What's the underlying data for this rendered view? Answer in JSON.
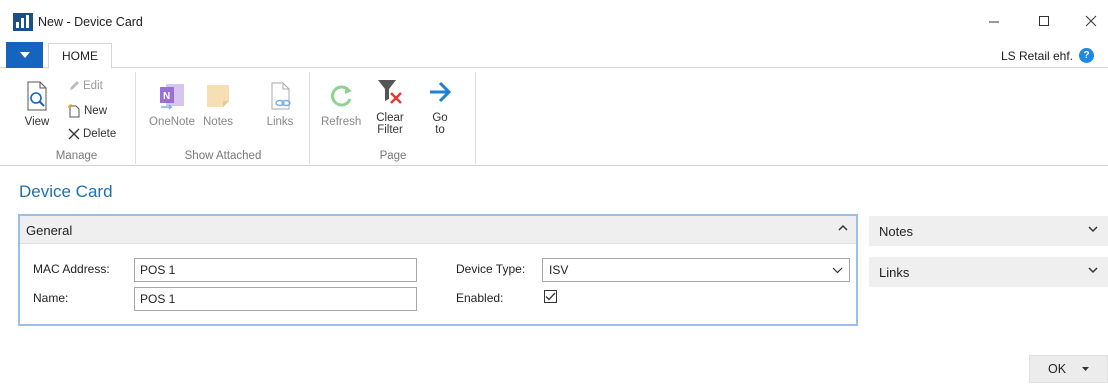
{
  "window": {
    "title": "New - Device Card",
    "controls": [
      "minimize-icon",
      "maximize-icon",
      "close-icon"
    ]
  },
  "ribbon": {
    "active_tab": "HOME",
    "company": "LS Retail ehf.",
    "groups": {
      "manage": {
        "label": "Manage",
        "view": "View",
        "edit": "Edit",
        "new": "New",
        "delete": "Delete"
      },
      "show_attached": {
        "label": "Show Attached",
        "onenote": "OneNote",
        "notes": "Notes",
        "links": "Links"
      },
      "page": {
        "label": "Page",
        "refresh": "Refresh",
        "clear_filter_1": "Clear",
        "clear_filter_2": "Filter",
        "goto_1": "Go",
        "goto_2": "to"
      }
    }
  },
  "page": {
    "title": "Device Card"
  },
  "general": {
    "title": "General",
    "mac_label": "MAC Address:",
    "mac_value": "POS 1",
    "name_label": "Name:",
    "name_value": "POS 1",
    "device_type_label": "Device Type:",
    "device_type_value": "ISV",
    "enabled_label": "Enabled:",
    "enabled": true
  },
  "factboxes": {
    "notes": "Notes",
    "links": "Links"
  },
  "footer": {
    "ok": "OK"
  },
  "colors": {
    "accent": "#1565c0",
    "title_blue": "#1f6fb4",
    "focus_border": "#9bbfe6"
  }
}
